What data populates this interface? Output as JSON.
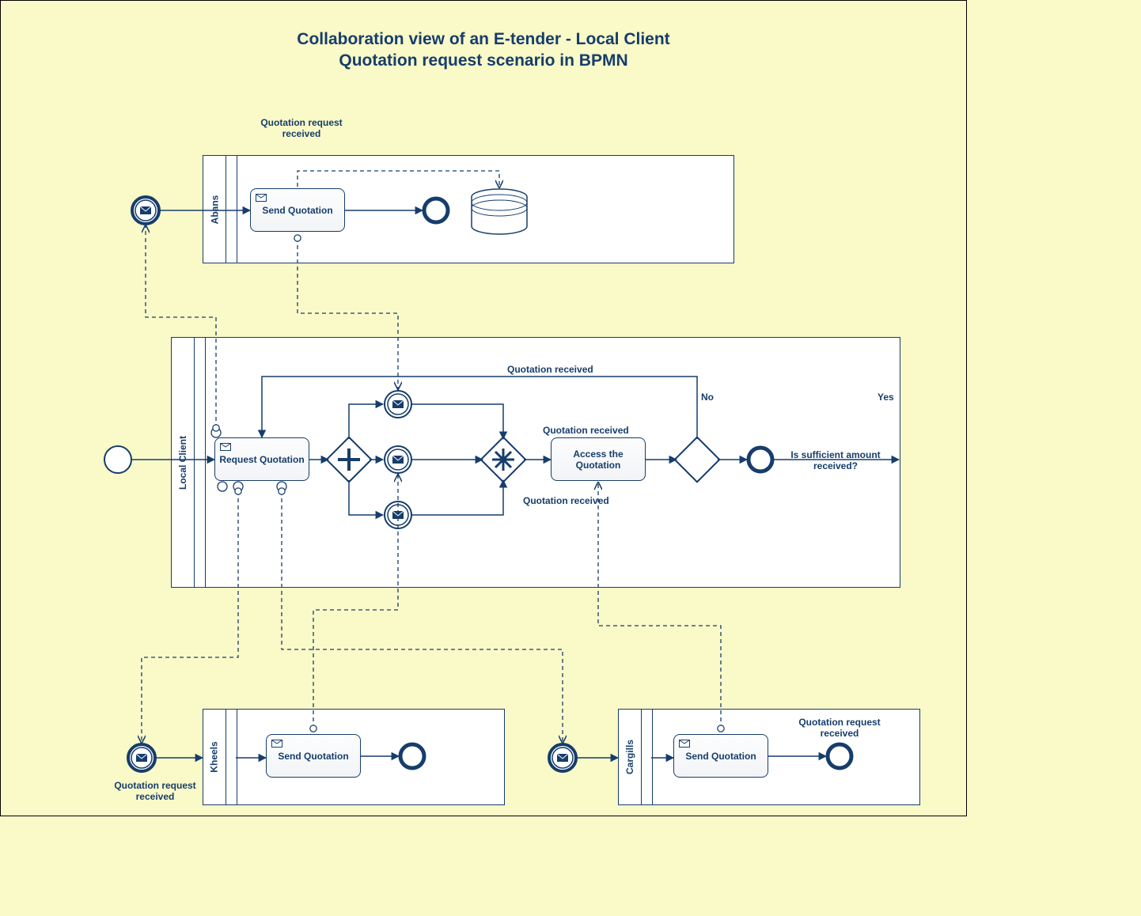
{
  "title_line1": "Collaboration view of an E-tender - Local Client",
  "title_line2": "Quotation request scenario in BPMN",
  "pools": {
    "abans": {
      "name": "Abans",
      "task": "Send Quotation",
      "event_label": "Quotation request received"
    },
    "local_client": {
      "name": "Local Client",
      "task_request": "Request Quotation",
      "task_access": "Access the Quotation",
      "msg_top": "Quotation received",
      "msg_mid": "Quotation received",
      "msg_bot": "Quotation received",
      "gateway_label": "Is sufficient amount received?",
      "edge_no": "No",
      "edge_yes": "Yes"
    },
    "kheels": {
      "name": "Kheels",
      "task": "Send Quotation",
      "event_label": "Quotation request received"
    },
    "cargills": {
      "name": "Cargills",
      "task": "Send Quotation",
      "event_label": "Quotation request received"
    }
  }
}
